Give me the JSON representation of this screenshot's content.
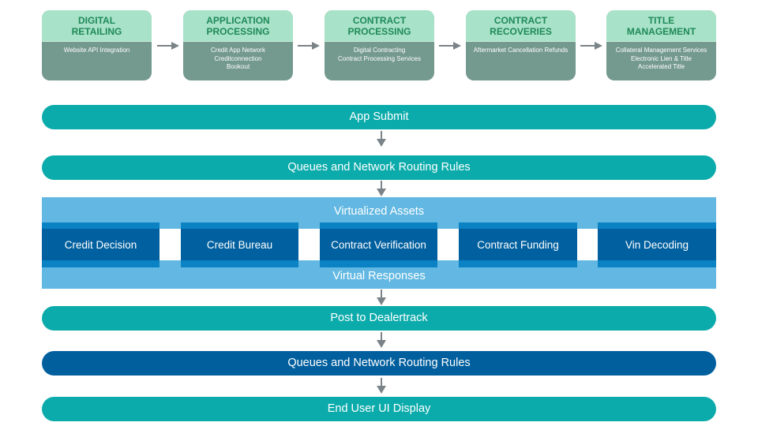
{
  "stages": [
    {
      "title_lines": [
        "DIGITAL",
        "RETAILING"
      ],
      "items": [
        "Website API Integration"
      ]
    },
    {
      "title_lines": [
        "APPLICATION",
        "PROCESSING"
      ],
      "items": [
        "Credit App Network",
        "Creditconnection",
        "Bookout"
      ]
    },
    {
      "title_lines": [
        "CONTRACT",
        "PROCESSING"
      ],
      "items": [
        "Digital Contracting",
        "Contract Processing Services"
      ]
    },
    {
      "title_lines": [
        "CONTRACT",
        "RECOVERIES"
      ],
      "items": [
        "Aftermarket Cancellation Refunds"
      ]
    },
    {
      "title_lines": [
        "TITLE",
        "MANAGEMENT"
      ],
      "items": [
        "Collateral Management Services",
        "Electronic Lien & Title",
        "Accelerated Title"
      ]
    }
  ],
  "flow": {
    "app_submit": "App Submit",
    "queues_routing_1": "Queues and Network Routing Rules",
    "virtualized_assets": "Virtualized Assets",
    "assets": [
      "Credit Decision",
      "Credit Bureau",
      "Contract Verification",
      "Contract Funding",
      "Vin Decoding"
    ],
    "virtual_responses": "Virtual Responses",
    "post_to_dealertrack": "Post to Dealertrack",
    "queues_routing_2": "Queues and Network Routing Rules",
    "end_user_ui": "End User UI Display"
  },
  "colors": {
    "card_header": "#a8e2c8",
    "card_title": "#1e8a58",
    "card_body": "#74998f",
    "teal_bar": "#0cabab",
    "navy_bar": "#015f9e",
    "panel": "#62b8e2",
    "asset_outer": "#0a82c3",
    "asset_inner": "#01609f",
    "arrow": "#7a8388"
  },
  "icons": {
    "horizontal_arrow": "arrow-right-icon",
    "vertical_arrow": "arrow-down-icon"
  }
}
